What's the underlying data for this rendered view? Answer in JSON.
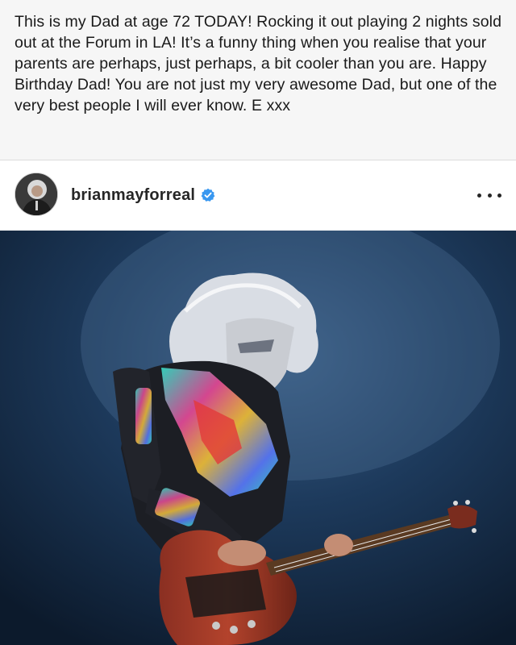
{
  "caption": {
    "text": "This is my Dad at age 72 TODAY! Rocking it out playing 2 nights sold out at the Forum in LA! It’s a funny thing when you realise that your parents are perhaps, just perhaps, a bit cooler than you are. Happy Birthday Dad! You are not just my very awesome Dad, but one of the very best people I will ever know. E xxx"
  },
  "post": {
    "username": "brianmayforreal",
    "verified_icon": "verified-badge-icon",
    "more_icon": "more-options-icon",
    "verified_color": "#3897f0",
    "photo_description_icon": "concert-photo"
  }
}
